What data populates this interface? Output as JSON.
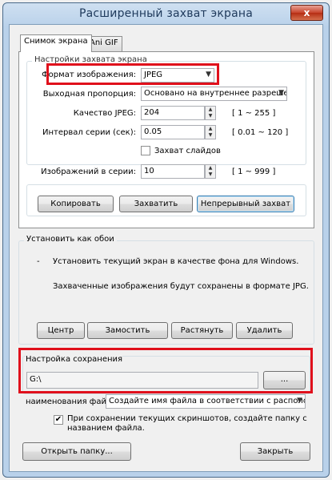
{
  "window": {
    "title": "Расширенный захват экрана",
    "close_glyph": "x"
  },
  "tabs": [
    {
      "label": "Снимок экрана",
      "active": true
    },
    {
      "label": "Ani GIF",
      "active": false
    }
  ],
  "capture_settings": {
    "group_label": "Настройки захвата экрана",
    "image_format": {
      "label": "Формат изображения:",
      "value": "JPEG"
    },
    "output_ratio": {
      "label": "Выходная пропорция:",
      "value": "Основано на внутреннее разрешение"
    },
    "jpeg_quality": {
      "label": "Качество JPEG:",
      "value": "204",
      "range": "[ 1 ~ 255 ]"
    },
    "series_interval": {
      "label": "Интервал серии (сек):",
      "value": "0.05",
      "range": "[ 0.01 ~ 120 ]"
    },
    "capture_slides": {
      "label": "Захват слайдов",
      "checked": false
    },
    "images_in_series": {
      "label": "Изображений в серии:",
      "value": "10",
      "range": "[ 1 ~ 999 ]"
    },
    "buttons": {
      "copy": "Копировать",
      "capture": "Захватить",
      "continuous": "Непрерывный захват"
    }
  },
  "wallpaper": {
    "group_label": "Установить как обои",
    "bullet": "-",
    "description": "Установить текущий экран в качестве фона для Windows.",
    "note": "Захваченные изображения будут сохранены в формате JPG.",
    "buttons": {
      "center": "Центр",
      "tile": "Замостить",
      "stretch": "Растянуть",
      "delete": "Удалить"
    }
  },
  "save_settings": {
    "group_label": "Настройка сохранения",
    "path": "G:\\",
    "browse_label": "...",
    "file_naming": {
      "label": "наименования файл:",
      "value": "Создайте имя файла в соответствии с расположени"
    },
    "folder_option": {
      "label_line1": "При сохранении текущих скриншотов, создайте папку с",
      "label_line2": "названием файла.",
      "checked": true
    }
  },
  "footer": {
    "open_folder": "Открыть папку...",
    "close": "Закрыть"
  },
  "icons": {
    "dropdown_arrow": "▼",
    "spin_up": "▲",
    "spin_down": "▼",
    "check_mark": "✔"
  },
  "colors": {
    "highlight": "#e0101c",
    "title_text": "#1e395b",
    "close_button": "#c7432b"
  }
}
